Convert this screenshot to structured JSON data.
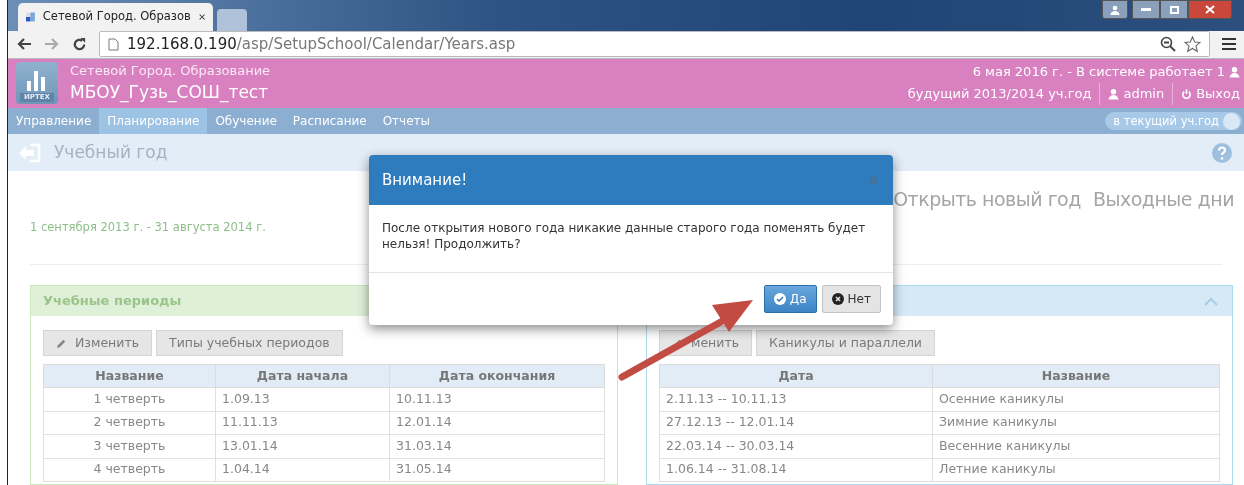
{
  "browser": {
    "tab_title": "Сетевой Город. Образов",
    "url_host": "192.168.0.190",
    "url_path": "/asp/SetupSchool/Calendar/Years.asp"
  },
  "header": {
    "logo_text": "ИРТЕХ",
    "system": "Сетевой Город. Образование",
    "school": "МБОУ_Гузь_СОШ_тест",
    "status": "6 мая 2016 г. - В системе работает 1",
    "year": "будущий 2013/2014 уч.год",
    "user": "admin",
    "logout": "Выход"
  },
  "nav": {
    "items": [
      {
        "label": "Управление",
        "selected": false
      },
      {
        "label": "Планирование",
        "selected": true
      },
      {
        "label": "Обучение",
        "selected": false
      },
      {
        "label": "Расписание",
        "selected": false
      },
      {
        "label": "Отчеты",
        "selected": false
      }
    ],
    "toggle": {
      "label": "в текущий уч.год",
      "on": false
    }
  },
  "page": {
    "title": "Учебный год",
    "period": "1 сентября 2013 г. - 31 августа 2014 г.",
    "actions": [
      "Открыть новый год",
      "Выходные дни"
    ]
  },
  "periods_panel": {
    "title": "Учебные периоды",
    "buttons": [
      {
        "label": "Изменить",
        "kind": "edit"
      },
      {
        "label": "Типы учебных периодов",
        "kind": "plain"
      }
    ],
    "columns": [
      "Название",
      "Дата начала",
      "Дата окончания"
    ],
    "rows": [
      [
        "1 четверть",
        "1.09.13",
        "10.11.13"
      ],
      [
        "2 четверть",
        "11.11.13",
        "12.01.14"
      ],
      [
        "3 четверть",
        "13.01.14",
        "31.03.14"
      ],
      [
        "4 четверть",
        "1.04.14",
        "31.05.14"
      ]
    ]
  },
  "holidays_panel": {
    "expanded": true,
    "buttons": [
      {
        "label": "менить",
        "kind": "edit"
      },
      {
        "label": "Каникулы и параллели",
        "kind": "plain"
      }
    ],
    "columns": [
      "Дата",
      "Название"
    ],
    "rows": [
      [
        "2.11.13 -- 10.11.13",
        "Осенние каникулы"
      ],
      [
        "27.12.13 -- 12.01.14",
        "Зимние каникулы"
      ],
      [
        "22.03.14 -- 30.03.14",
        "Весенние каникулы"
      ],
      [
        "1.06.14 -- 31.08.14",
        "Летние каникулы"
      ]
    ]
  },
  "modal": {
    "title": "Внимание!",
    "message": "После открытия нового года никакие данные старого года поменять будет нельзя! Продолжить?",
    "buttons": [
      {
        "label": "Да",
        "kind": "confirm"
      },
      {
        "label": "Нет",
        "kind": "cancel"
      }
    ]
  }
}
